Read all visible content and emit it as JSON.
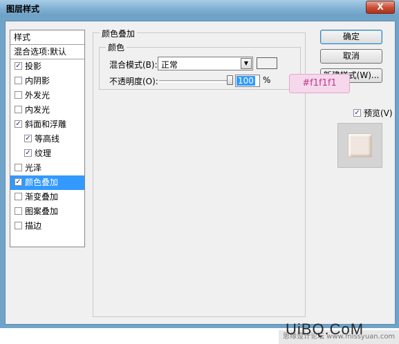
{
  "window": {
    "title": "图层样式",
    "close_label": "X"
  },
  "style_list": {
    "header": "样式",
    "blend_options": "混合选项:默认",
    "items": [
      {
        "label": "投影",
        "checked": true
      },
      {
        "label": "内阴影",
        "checked": false
      },
      {
        "label": "外发光",
        "checked": false
      },
      {
        "label": "内发光",
        "checked": false
      },
      {
        "label": "斜面和浮雕",
        "checked": true
      },
      {
        "label": "等高线",
        "checked": true,
        "sub": true
      },
      {
        "label": "纹理",
        "checked": true,
        "sub": true
      },
      {
        "label": "光泽",
        "checked": false
      },
      {
        "label": "颜色叠加",
        "checked": true,
        "selected": true
      },
      {
        "label": "渐变叠加",
        "checked": false
      },
      {
        "label": "图案叠加",
        "checked": false
      },
      {
        "label": "描边",
        "checked": false
      }
    ]
  },
  "panel": {
    "group_title": "颜色叠加",
    "sub_group_title": "颜色",
    "blend_mode_label": "混合模式(B):",
    "blend_mode_value": "正常",
    "opacity_label": "不透明度(O):",
    "opacity_value": "100",
    "opacity_unit": "%",
    "color_swatch": "#f1f1f1"
  },
  "buttons": {
    "ok": "确定",
    "cancel": "取消",
    "new_style": "新建样式(W)...",
    "preview_label": "预览(V)",
    "preview_checked": true
  },
  "annotation": {
    "color_text": "#f1f1f1"
  },
  "watermark": {
    "logo": "UiBQ.CoM",
    "text": "思缘设计论坛 www.missyuan.com"
  }
}
